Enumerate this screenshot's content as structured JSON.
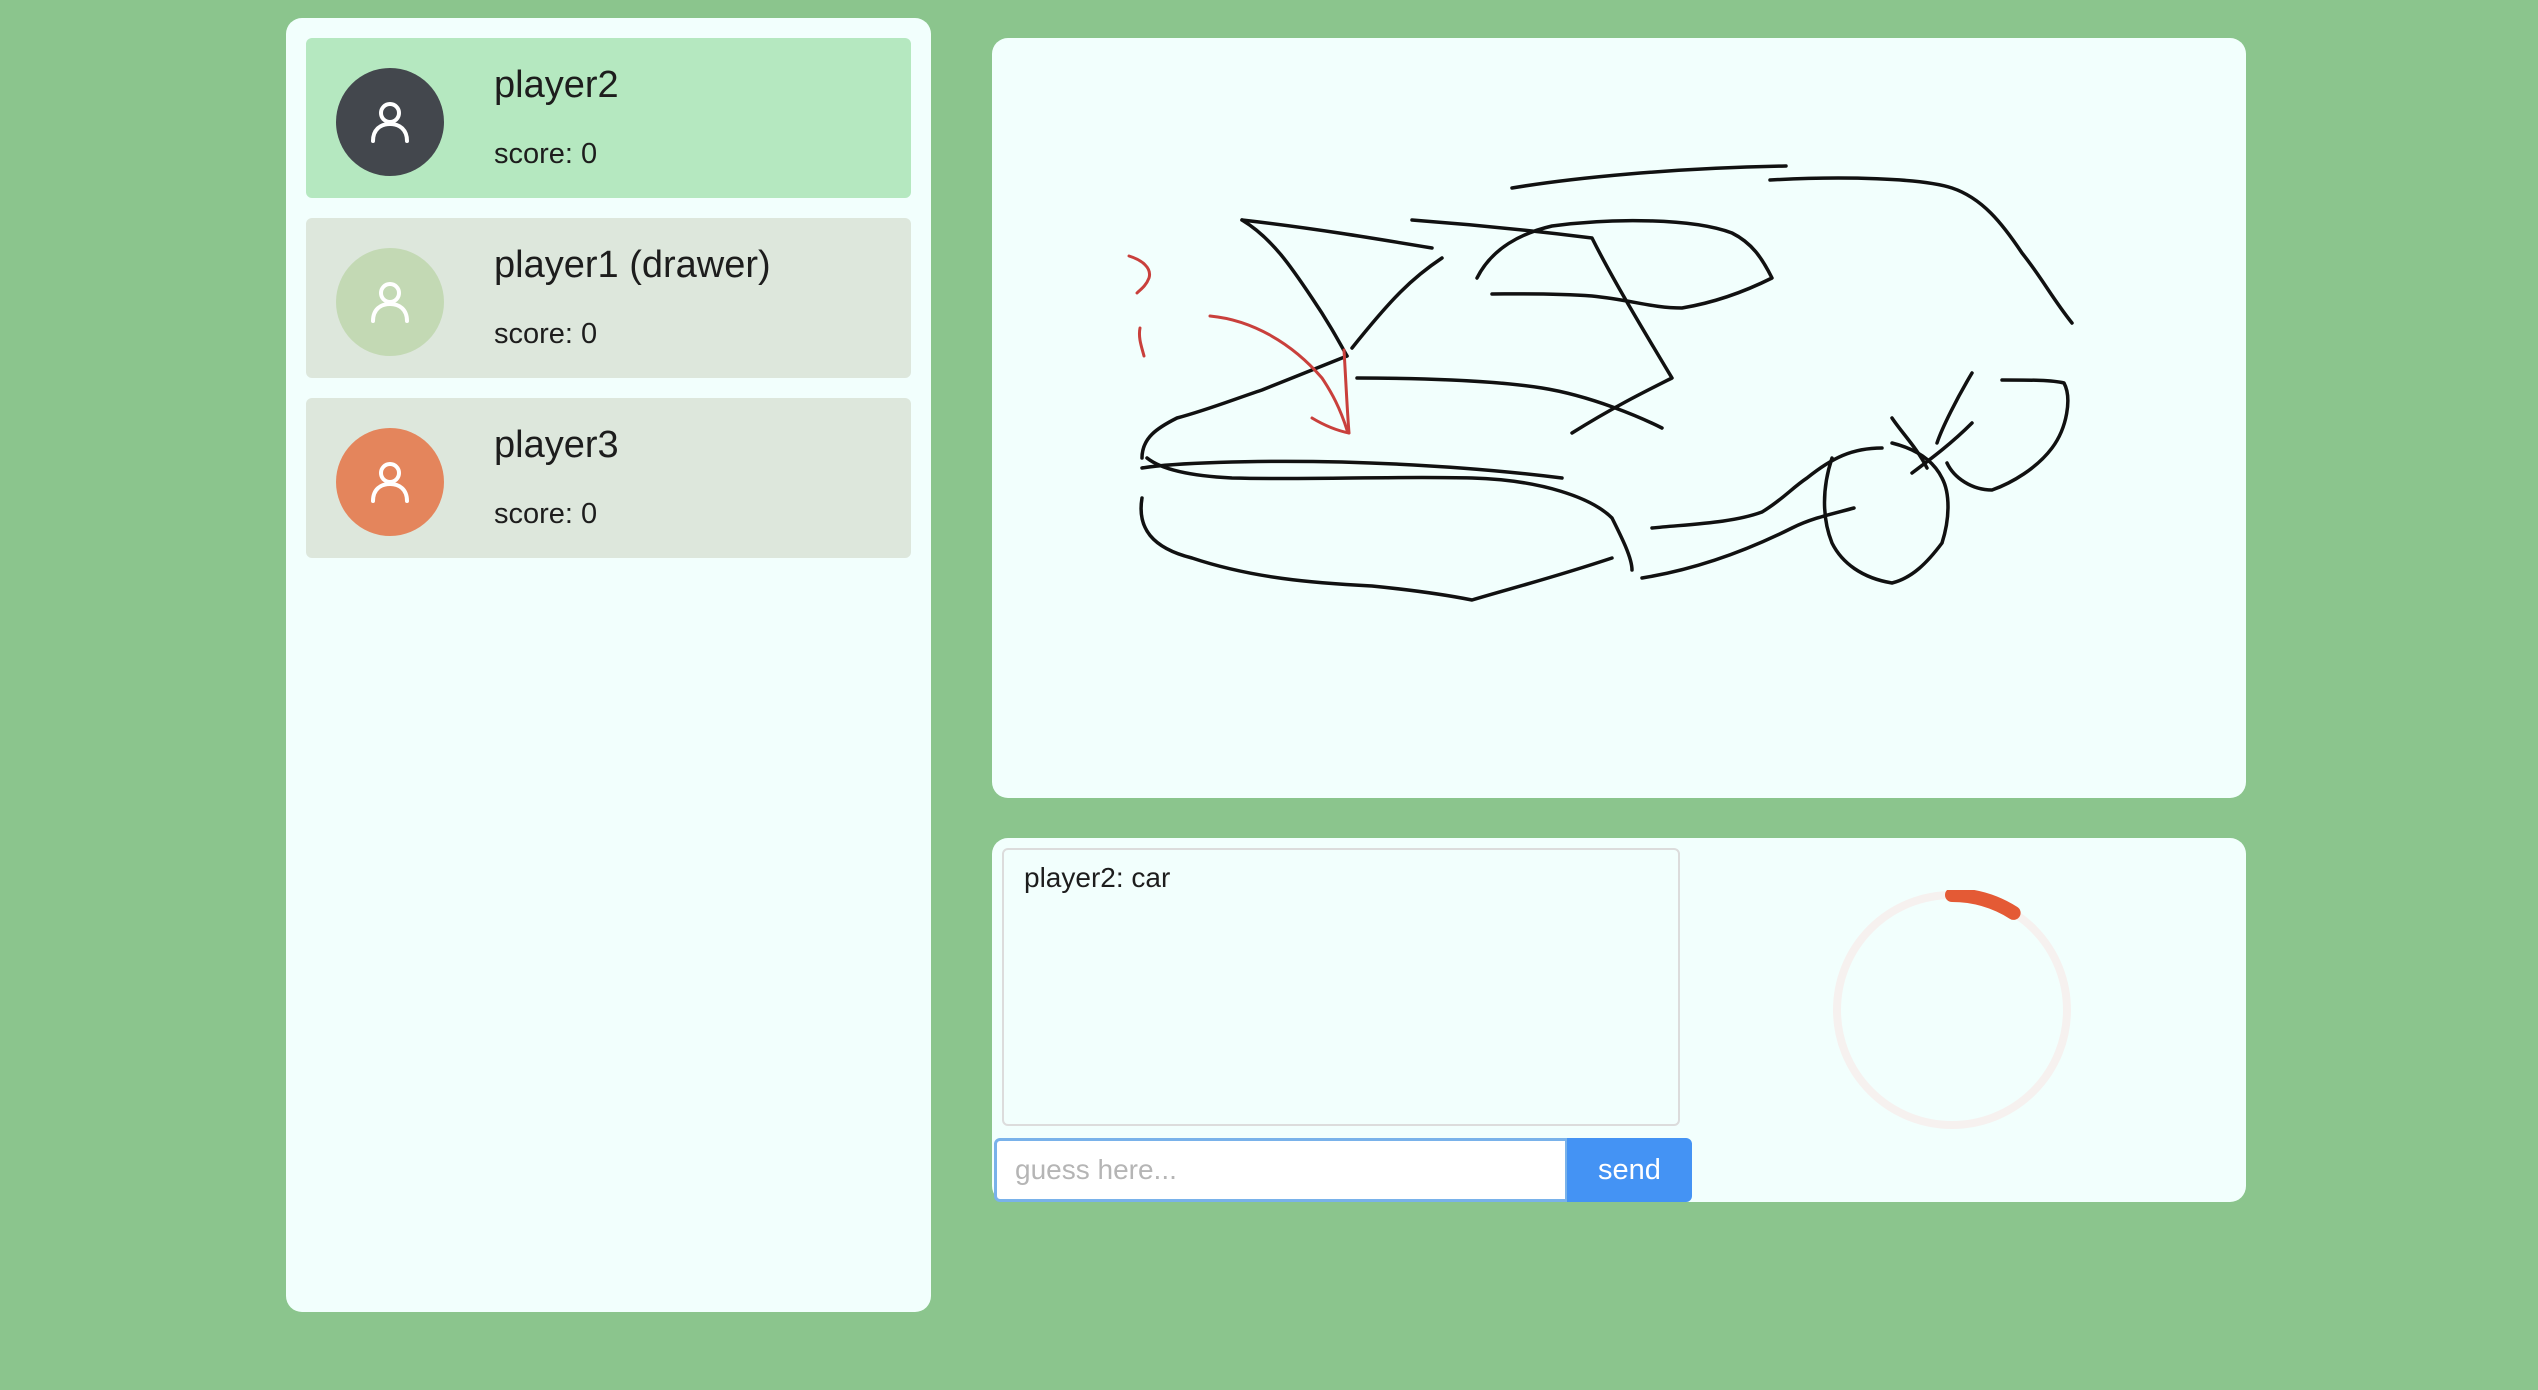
{
  "players": [
    {
      "name": "player2",
      "score": "score: 0",
      "avatar_color": "#43474d",
      "icon": "user-icon",
      "active": true
    },
    {
      "name": "player1 (drawer)",
      "score": "score: 0",
      "avatar_color": "#c3d9b4",
      "icon": "user-icon",
      "active": false
    },
    {
      "name": "player3",
      "score": "score: 0",
      "avatar_color": "#e4855c",
      "icon": "user-icon",
      "active": false
    }
  ],
  "chat": {
    "messages": [
      "player2: car"
    ],
    "input_placeholder": "guess here...",
    "input_value": "",
    "send_label": "send"
  },
  "timer": {
    "fraction_remaining": 0.09,
    "track_color": "#f6f1ef",
    "progress_color": "#e45a35"
  },
  "colors": {
    "background": "#8bc58d",
    "panel": "#f2fffd",
    "active_card": "#b5e8c0",
    "card": "#dde7dc",
    "button": "#4493f4",
    "ink_black": "#111111",
    "ink_red": "#c9403c"
  }
}
